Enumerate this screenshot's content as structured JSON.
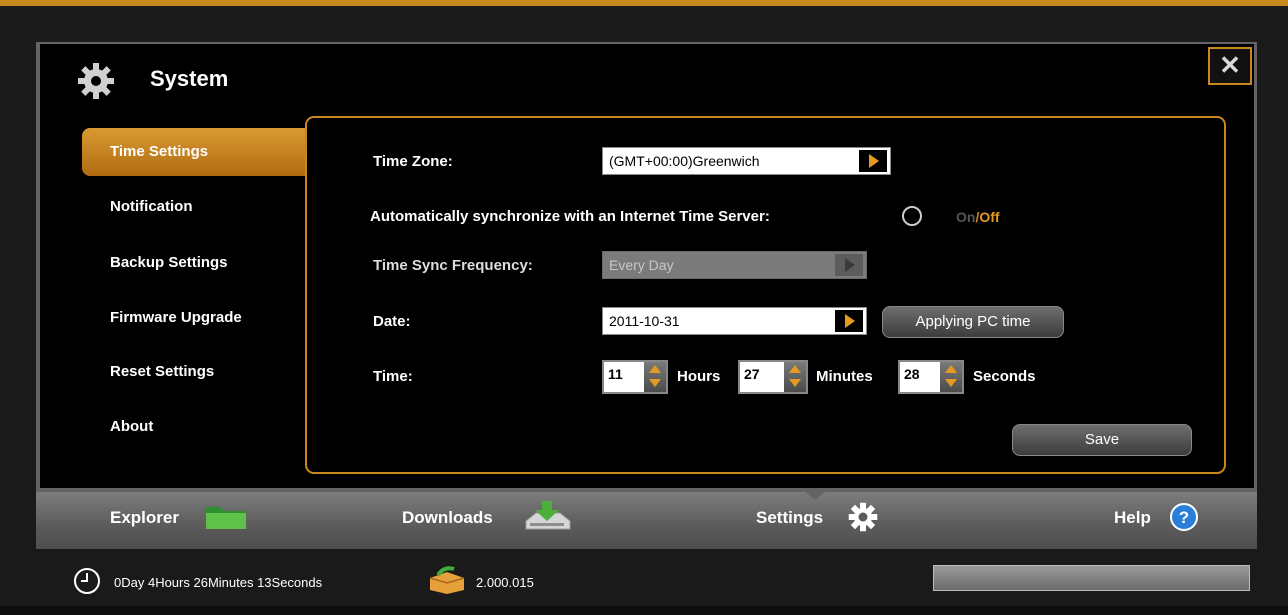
{
  "dialog": {
    "title": "System",
    "title_icon": "gear-icon",
    "close_icon": "close-icon",
    "close_label": "✕"
  },
  "sidebar": {
    "items": [
      {
        "label": "Time Settings",
        "active": true
      },
      {
        "label": "Notification",
        "active": false
      },
      {
        "label": "Backup Settings",
        "active": false
      },
      {
        "label": "Firmware Upgrade",
        "active": false
      },
      {
        "label": "Reset Settings",
        "active": false
      },
      {
        "label": "About",
        "active": false
      }
    ]
  },
  "time_settings": {
    "time_zone_label": "Time Zone:",
    "time_zone_value": "(GMT+00:00)Greenwich",
    "auto_sync_label": "Automatically synchronize with an Internet Time Server:",
    "auto_sync_on": "On",
    "auto_sync_sep": "/",
    "auto_sync_off": "Off",
    "auto_sync_state": "Off",
    "sync_freq_label": "Time Sync Frequency:",
    "sync_freq_value": "Every Day",
    "date_label": "Date:",
    "date_value": "2011-10-31",
    "apply_pc_time_label": "Applying PC time",
    "time_label": "Time:",
    "hours_value": "11",
    "hours_unit": "Hours",
    "minutes_value": "27",
    "minutes_unit": "Minutes",
    "seconds_value": "28",
    "seconds_unit": "Seconds",
    "save_label": "Save"
  },
  "navbar": {
    "items": [
      {
        "label": "Explorer",
        "icon": "folder-icon"
      },
      {
        "label": "Downloads",
        "icon": "download-icon"
      },
      {
        "label": "Settings",
        "icon": "gear-icon",
        "active": true
      },
      {
        "label": "Help",
        "icon": "help-icon"
      }
    ]
  },
  "status": {
    "uptime": "0Day 4Hours 26Minutes 13Seconds",
    "uptime_icon": "clock-icon",
    "version": "2.000.015",
    "version_icon": "package-icon"
  },
  "colors": {
    "accent": "#c8871f",
    "arrow": "#e69a22"
  }
}
